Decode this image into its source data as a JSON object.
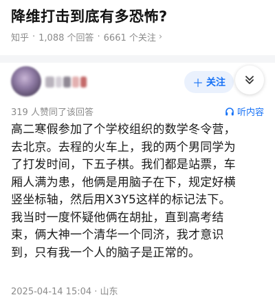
{
  "question": {
    "title": "降维打击到底有多恐怖?",
    "source": "知乎",
    "answers": "1,088 个回答",
    "followers": "6661 个关注"
  },
  "author": {
    "follow_label": "关注"
  },
  "answer": {
    "upvote_text": "319 人赞同了该回答",
    "listen_label": "听内容",
    "lines": [
      "高二寒假参加了个学校组织的数学冬令营，",
      "去北京。去程的火车上，我的两个男同学为",
      "了打发时间，下五子棋。我们都是站票，车",
      "厢人满为患，他俩是用脑子在下，规定好横",
      "竖坐标轴，然后用X3Y5这样的标记法下。",
      "我当时一度怀疑他俩在胡扯，直到高考结",
      "束，俩大神一个清华一个同济，我才意识",
      "到，只有我一个人的脑子是正常的。"
    ],
    "footer": "2025-04-14 15:04 · 山东"
  },
  "colors": {
    "accent": "#1772f6",
    "meta": "#8a8a8a",
    "follow_bg": "#eaf1fd"
  }
}
